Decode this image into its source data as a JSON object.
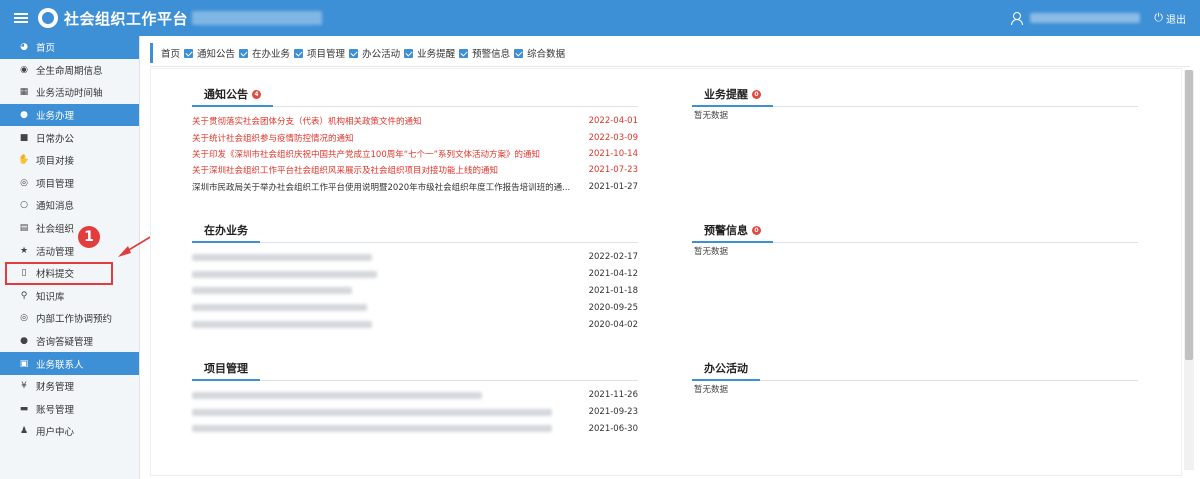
{
  "header": {
    "title": "社会组织工作平台",
    "logout_label": "退出",
    "logout_icon": "power-icon"
  },
  "sidebar": {
    "items": [
      {
        "label": "首页",
        "icon": "dashboard-icon",
        "active": true
      },
      {
        "label": "全生命周期信息",
        "icon": "eye-icon"
      },
      {
        "label": "业务活动时间轴",
        "icon": "calendar-icon"
      },
      {
        "label": "业务办理",
        "icon": "info-icon",
        "active": true
      },
      {
        "label": "日常办公",
        "icon": "briefcase-icon"
      },
      {
        "label": "项目对接",
        "icon": "handshake-icon"
      },
      {
        "label": "项目管理",
        "icon": "eye-outline-icon"
      },
      {
        "label": "通知消息",
        "icon": "chat-bubble-icon"
      },
      {
        "label": "社会组织",
        "icon": "id-card-icon"
      },
      {
        "label": "活动管理",
        "icon": "star-icon"
      },
      {
        "label": "材料提交",
        "icon": "document-icon",
        "highlighted": true
      },
      {
        "label": "知识库",
        "icon": "search-icon"
      },
      {
        "label": "内部工作协调预约",
        "icon": "eye-outline-icon"
      },
      {
        "label": "咨询答疑管理",
        "icon": "chat-icon"
      },
      {
        "label": "业务联系人",
        "icon": "contact-icon",
        "active": true
      },
      {
        "label": "财务管理",
        "icon": "yen-icon"
      },
      {
        "label": "账号管理",
        "icon": "account-card-icon"
      },
      {
        "label": "用户中心",
        "icon": "user-icon"
      }
    ]
  },
  "annotation": {
    "number": "1",
    "color": "#e23c3c"
  },
  "breadcrumb": [
    "首页",
    "通知公告",
    "在办业务",
    "项目管理",
    "办公活动",
    "业务提醒",
    "预警信息",
    "综合数据"
  ],
  "notices": {
    "title": "通知公告",
    "badge": "4",
    "items": [
      {
        "text": "关于贯彻落实社会团体分支（代表）机构相关政策文件的通知",
        "date": "2022-04-01",
        "color": "red"
      },
      {
        "text": "关于统计社会组织参与疫情防控情况的通知",
        "date": "2022-03-09",
        "color": "red"
      },
      {
        "text": "关于印发《深圳市社会组织庆祝中国共产党成立100周年“七个一”系列文体活动方案》的通知",
        "date": "2021-10-14",
        "color": "red"
      },
      {
        "text": "关于深圳社会组织工作平台社会组织风采展示及社会组织项目对接功能上线的通知",
        "date": "2021-07-23",
        "color": "red"
      },
      {
        "text": "深圳市民政局关于举办社会组织工作平台使用说明暨2020年市级社会组织年度工作报告培训班的通...",
        "date": "2021-01-27",
        "color": "dark"
      }
    ]
  },
  "business_reminder": {
    "title": "业务提醒",
    "badge": "0",
    "empty": "暂无数据"
  },
  "in_progress": {
    "title": "在办业务",
    "dates": [
      "2022-02-17",
      "2021-04-12",
      "2021-01-18",
      "2020-09-25",
      "2020-04-02"
    ]
  },
  "warnings": {
    "title": "预警信息",
    "badge": "0",
    "empty": "暂无数据"
  },
  "projects": {
    "title": "项目管理",
    "dates": [
      "2021-11-26",
      "2021-09-23",
      "2021-06-30"
    ]
  },
  "office": {
    "title": "办公活动",
    "empty": "暂无数据"
  }
}
